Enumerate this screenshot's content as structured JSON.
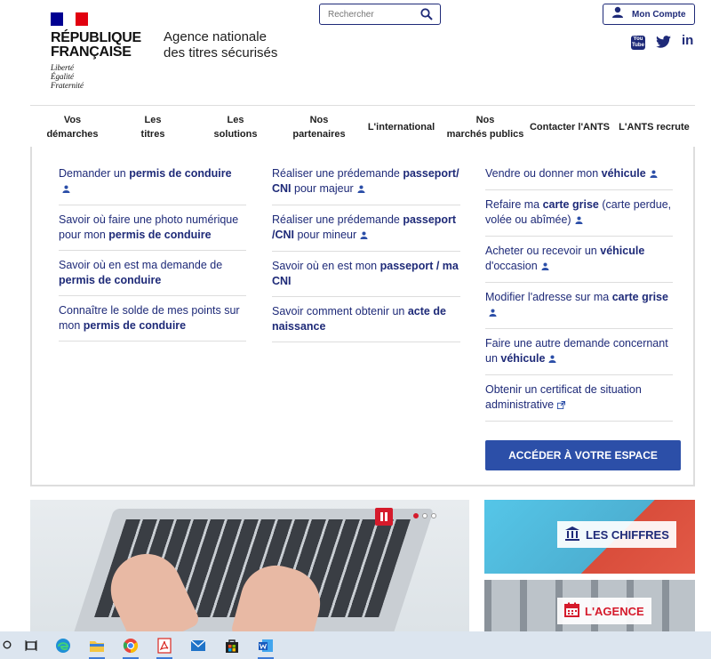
{
  "header": {
    "republique_line1": "RÉPUBLIQUE",
    "republique_line2": "FRANÇAISE",
    "motto_1": "Liberté",
    "motto_2": "Égalité",
    "motto_3": "Fraternité",
    "agency_line1": "Agence nationale",
    "agency_line2": "des titres sécurisés",
    "search_placeholder": "Rechercher",
    "account_label": "Mon Compte",
    "social": [
      "YouTube",
      "Twitter",
      "LinkedIn"
    ],
    "social_yt_text": "You Tube",
    "social_li_text": "in"
  },
  "nav": [
    {
      "l1": "Vos",
      "l2": "démarches"
    },
    {
      "l1": "Les",
      "l2": "titres"
    },
    {
      "l1": "Les",
      "l2": "solutions"
    },
    {
      "l1": "Nos",
      "l2": "partenaires"
    },
    {
      "l1": "L'international",
      "l2": ""
    },
    {
      "l1": "Nos",
      "l2": "marchés publics"
    },
    {
      "l1": "Contacter l'ANTS",
      "l2": ""
    },
    {
      "l1": "L'ANTS recrute",
      "l2": ""
    }
  ],
  "menu": {
    "col1": [
      {
        "pre": "Demander un ",
        "bold": "permis de conduire",
        "post": ""
      },
      {
        "pre": "Savoir où faire une photo numérique pour mon ",
        "bold": "permis de conduire",
        "post": ""
      },
      {
        "pre": "Savoir où en est ma demande de ",
        "bold": "permis de conduire",
        "post": ""
      },
      {
        "pre": "Connaître le solde de mes points sur mon ",
        "bold": "permis de conduire",
        "post": ""
      }
    ],
    "col2": [
      {
        "pre": "Réaliser une prédemande ",
        "bold": "passeport/ CNI",
        "post": " pour majeur"
      },
      {
        "pre": "Réaliser une prédemande ",
        "bold": "passeport /CNI",
        "post": " pour mineur"
      },
      {
        "pre": "Savoir où en est mon ",
        "bold": "passeport / ma CNI",
        "post": ""
      },
      {
        "pre": "Savoir comment obtenir un ",
        "bold": "acte de naissance",
        "post": ""
      }
    ],
    "col3": [
      {
        "pre": "Vendre ou donner mon ",
        "bold": "véhicule",
        "post": ""
      },
      {
        "pre": "Refaire ma ",
        "bold": "carte grise",
        "post": " (carte perdue, volée ou abîmée)"
      },
      {
        "pre": "Acheter ou recevoir un ",
        "bold": "véhicule",
        "post": " d'occasion"
      },
      {
        "pre": "Modifier l'adresse sur ma ",
        "bold": "carte grise",
        "post": ""
      },
      {
        "pre": "Faire une autre demande concernant un ",
        "bold": "véhicule",
        "post": ""
      },
      {
        "pre": "Obtenir un certificat de situation administrative",
        "bold": "",
        "post": ""
      }
    ],
    "cta": "ACCÉDER À VOTRE ESPACE"
  },
  "hero": {
    "slide_dots": [
      true,
      false,
      false
    ]
  },
  "side": {
    "chiffres": "LES CHIFFRES",
    "agence": "L'AGENCE"
  },
  "taskbar": [
    "search-icon",
    "task-view-icon",
    "edge-icon",
    "file-explorer-icon",
    "chrome-icon",
    "acrobat-icon",
    "mail-icon",
    "store-icon",
    "word-icon"
  ],
  "colors": {
    "navy": "#1e2a78",
    "link": "#1e2a78",
    "cta": "#2c4fa8",
    "red": "#d51a2b",
    "flag_blue": "#000091",
    "flag_red": "#e1000f"
  }
}
